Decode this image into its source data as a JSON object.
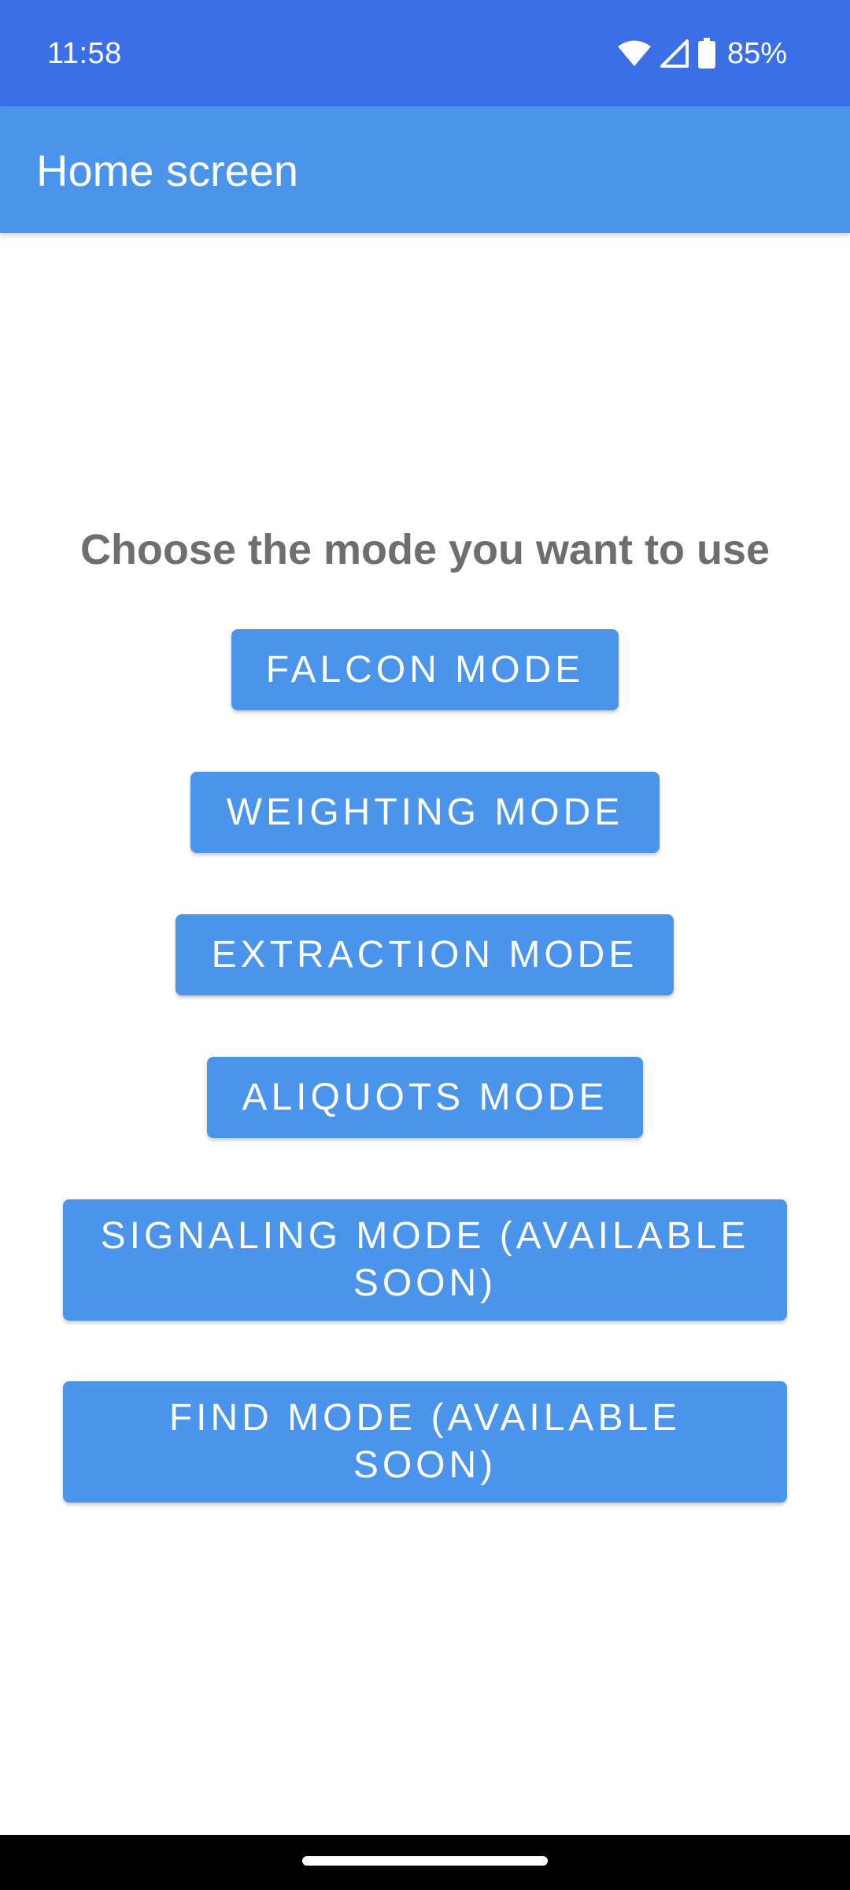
{
  "status_bar": {
    "time": "11:58",
    "battery_percent": "85%",
    "icons": [
      "wifi-icon",
      "cellular-signal-icon",
      "battery-icon"
    ]
  },
  "app_bar": {
    "title": "Home screen"
  },
  "main": {
    "prompt": "Choose the mode you want to use",
    "buttons": [
      {
        "label": "FALCON MODE"
      },
      {
        "label": "WEIGHTING MODE"
      },
      {
        "label": "EXTRACTION MODE"
      },
      {
        "label": "ALIQUOTS MODE"
      },
      {
        "label": "SIGNALING MODE (AVAILABLE SOON)"
      },
      {
        "label": "FIND MODE (AVAILABLE SOON)"
      }
    ]
  },
  "colors": {
    "status_bar": "#3b6fe8",
    "app_bar": "#4a94eb",
    "button": "#4a94eb",
    "prompt_text": "#6e6e6e"
  }
}
